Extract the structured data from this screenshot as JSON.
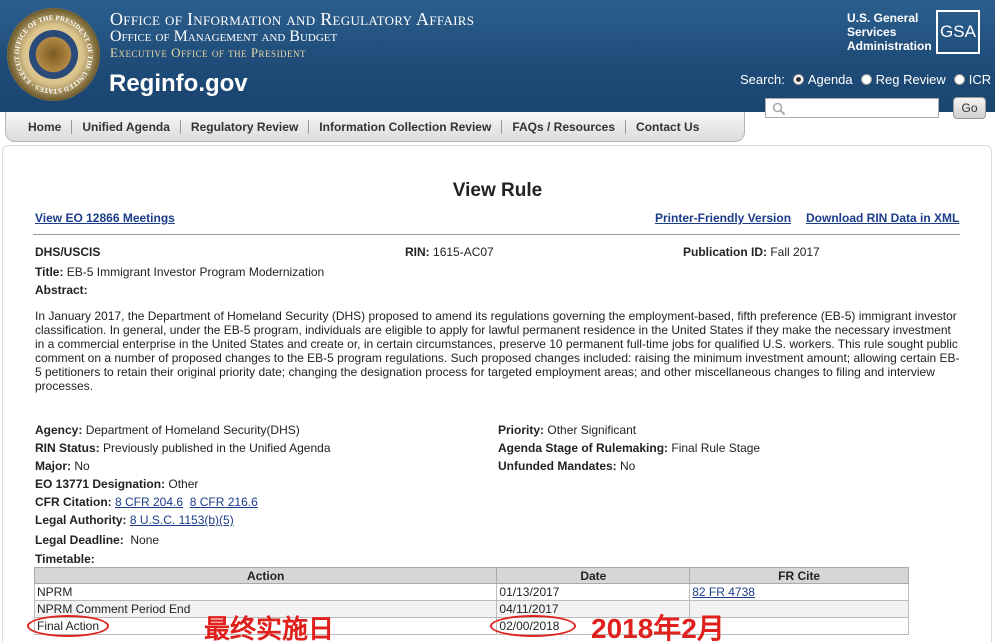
{
  "header": {
    "seal_text": "OFFICE OF THE PRESIDENT OF THE UNITED STATES · EXECUTIVE",
    "office_title": "Office of Information and Regulatory Affairs",
    "omb_title": "Office of Management and Budget",
    "eop_title": "Executive Office of the President",
    "site_name": "Reginfo.gov",
    "gsa_text": "U.S. General Services Administration",
    "gsa_logo": "GSA",
    "search": {
      "label": "Search:",
      "options": [
        "Agenda",
        "Reg Review",
        "ICR"
      ],
      "selected": "Agenda",
      "value": "",
      "go_label": "Go"
    }
  },
  "nav": {
    "items": [
      "Home",
      "Unified Agenda",
      "Regulatory Review",
      "Information Collection Review",
      "FAQs / Resources",
      "Contact Us"
    ]
  },
  "page": {
    "heading": "View Rule",
    "links": {
      "eo": "View EO 12866 Meetings",
      "printer": "Printer-Friendly Version",
      "xml": "Download RIN Data in XML"
    }
  },
  "rule": {
    "agency_short": "DHS/USCIS",
    "rin_label": "RIN:",
    "rin": "1615-AC07",
    "pub_label": "Publication ID:",
    "pub_id": "Fall 2017",
    "title_label": "Title:",
    "title": "EB-5 Immigrant Investor Program Modernization",
    "abstract_label": "Abstract:",
    "abstract": "In January 2017, the Department of Homeland Security (DHS) proposed to amend its regulations governing the employment-based, fifth preference (EB-5) immigrant investor classification.  In general, under the EB-5 program, individuals are eligible to apply for lawful permanent residence in the United States if they make the necessary investment in a commercial enterprise in the United States and create or, in certain circumstances, preserve 10 permanent full-time jobs for qualified U.S. workers. This rule sought public comment on a number of proposed changes to the EB-5 program regulations. Such proposed changes included: raising the minimum investment amount; allowing certain EB-5 petitioners to retain their original priority date; changing the designation process for targeted employment areas; and other miscellaneous changes to filing and interview processes.",
    "agency_label": "Agency:",
    "agency": "Department of Homeland Security(DHS)",
    "priority_label": "Priority:",
    "priority": "Other Significant",
    "rin_status_label": "RIN Status:",
    "rin_status": "Previously published in the Unified Agenda",
    "stage_label": "Agenda Stage of Rulemaking:",
    "stage": "Final Rule Stage",
    "major_label": "Major:",
    "major": "No",
    "unfunded_label": "Unfunded Mandates:",
    "unfunded": "No",
    "eo13771_label": "EO 13771 Designation:",
    "eo13771": "Other",
    "cfr_label": "CFR Citation:",
    "cfr": [
      "8 CFR 204.6",
      "8 CFR 216.6"
    ],
    "authority_label": "Legal Authority:",
    "authority": "8 U.S.C. 1153(b)(5)",
    "deadline_label": "Legal Deadline:",
    "deadline": "None",
    "timetable_label": "Timetable:"
  },
  "timetable": {
    "headers": [
      "Action",
      "Date",
      "FR Cite"
    ],
    "rows": [
      {
        "action": "NPRM",
        "date": "01/13/2017",
        "fr": "82 FR 4738"
      },
      {
        "action": "NPRM Comment Period End",
        "date": "04/11/2017",
        "fr": ""
      },
      {
        "action": "Final Action",
        "date": "02/00/2018",
        "fr": ""
      }
    ]
  },
  "annotations": {
    "final_note": "最终实施日",
    "date_note": "2018年2月",
    "color": "#e0201c"
  }
}
